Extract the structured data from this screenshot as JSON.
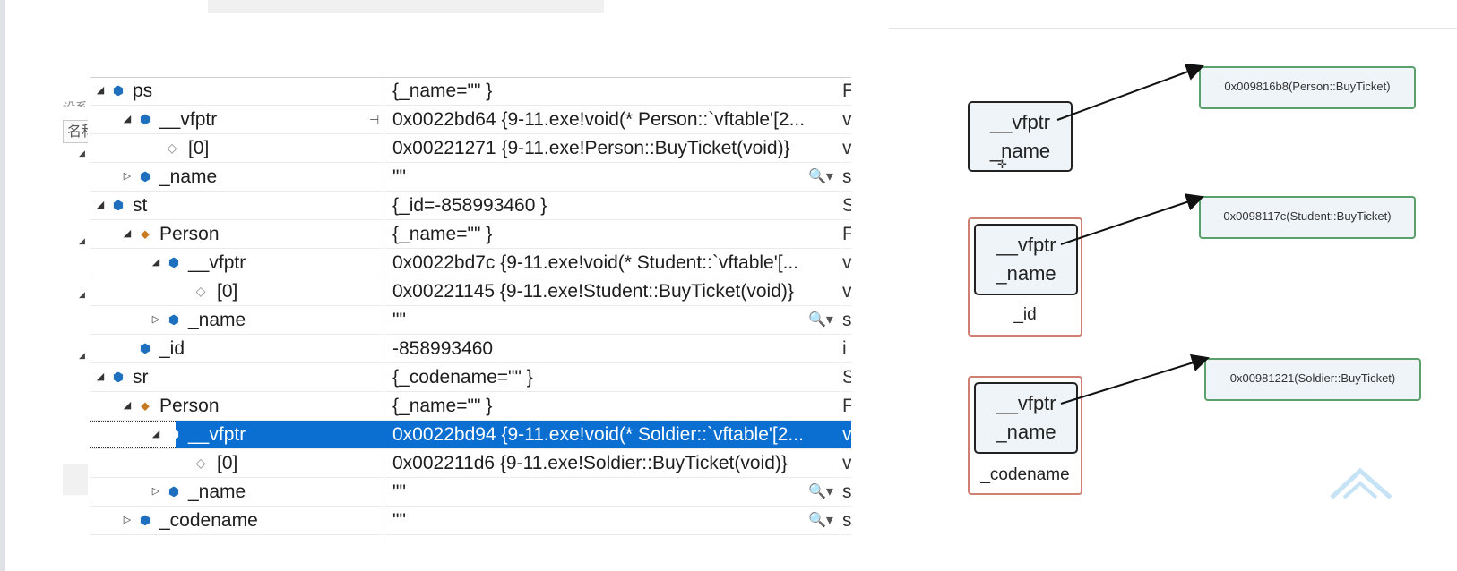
{
  "sidebar": {
    "frag_top": "设系",
    "frag_label": "名称"
  },
  "watch": {
    "rows": [
      {
        "label": "ps",
        "value": "{_name=\"\" }",
        "type": "F"
      },
      {
        "label": "__vfptr",
        "value": "0x0022bd64 {9-11.exe!void(* Person::`vftable'[2...",
        "type": "v"
      },
      {
        "label": "[0]",
        "value": "0x00221271 {9-11.exe!Person::BuyTicket(void)}",
        "type": "v"
      },
      {
        "label": "_name",
        "value": "\"\"",
        "type": "s"
      },
      {
        "label": "st",
        "value": "{_id=-858993460 }",
        "type": "S"
      },
      {
        "label": "Person",
        "value": "{_name=\"\" }",
        "type": "F"
      },
      {
        "label": "__vfptr",
        "value": "0x0022bd7c {9-11.exe!void(* Student::`vftable'[...",
        "type": "v"
      },
      {
        "label": "[0]",
        "value": "0x00221145 {9-11.exe!Student::BuyTicket(void)}",
        "type": "v"
      },
      {
        "label": "_name",
        "value": "\"\"",
        "type": "s"
      },
      {
        "label": "_id",
        "value": "-858993460",
        "type": "i"
      },
      {
        "label": "sr",
        "value": "{_codename=\"\" }",
        "type": "S"
      },
      {
        "label": "Person",
        "value": "{_name=\"\" }",
        "type": "F"
      },
      {
        "label": "__vfptr",
        "value": "0x0022bd94 {9-11.exe!void(* Soldier::`vftable'[2...",
        "type": "v"
      },
      {
        "label": "[0]",
        "value": "0x002211d6 {9-11.exe!Soldier::BuyTicket(void)}",
        "type": "v"
      },
      {
        "label": "_name",
        "value": "\"\"",
        "type": "s"
      },
      {
        "label": "_codename",
        "value": "\"\"",
        "type": "s"
      }
    ],
    "magnifier_glyph": "🔍▾",
    "pin_glyph": "⊣"
  },
  "diagram": {
    "objects": [
      {
        "field1": "__vfptr",
        "field2": "_name",
        "tail": ""
      },
      {
        "field1": "__vfptr",
        "field2": "_name",
        "tail": "_id"
      },
      {
        "field1": "__vfptr",
        "field2": "_name",
        "tail": "_codename"
      }
    ],
    "vtables": [
      {
        "text": "0x009816b8(Person::BuyTicket)"
      },
      {
        "text": "0x0098117c(Student::BuyTicket)"
      },
      {
        "text": "0x00981221(Soldier::BuyTicket)"
      }
    ],
    "colors": {
      "selection": "#0a6fd1",
      "object_border": "#222222",
      "derived_border": "#d08070",
      "vtable_border": "#5aa06a"
    }
  }
}
